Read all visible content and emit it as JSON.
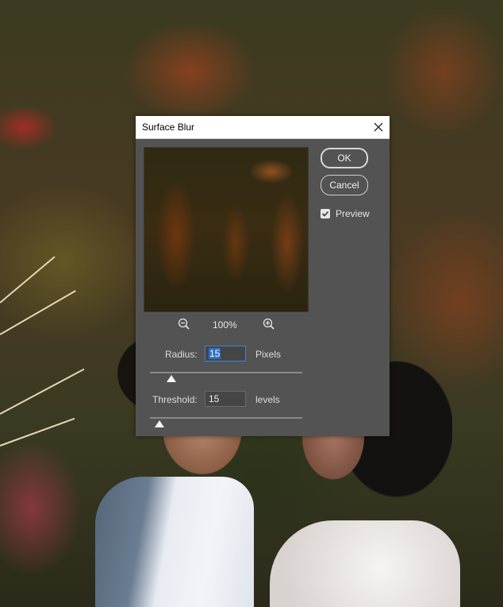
{
  "dialog": {
    "title": "Surface Blur",
    "ok_label": "OK",
    "cancel_label": "Cancel",
    "preview_label": "Preview",
    "preview_checked": true,
    "zoom_level": "100%",
    "zoom_out_icon": "zoom-out-icon",
    "zoom_in_icon": "zoom-in-icon",
    "close_icon": "close-icon"
  },
  "radius": {
    "label": "Radius:",
    "value": "15",
    "unit": "Pixels",
    "slider_fraction": 0.14
  },
  "threshold": {
    "label": "Threshold:",
    "value": "15",
    "unit": "levels",
    "slider_fraction": 0.06
  }
}
